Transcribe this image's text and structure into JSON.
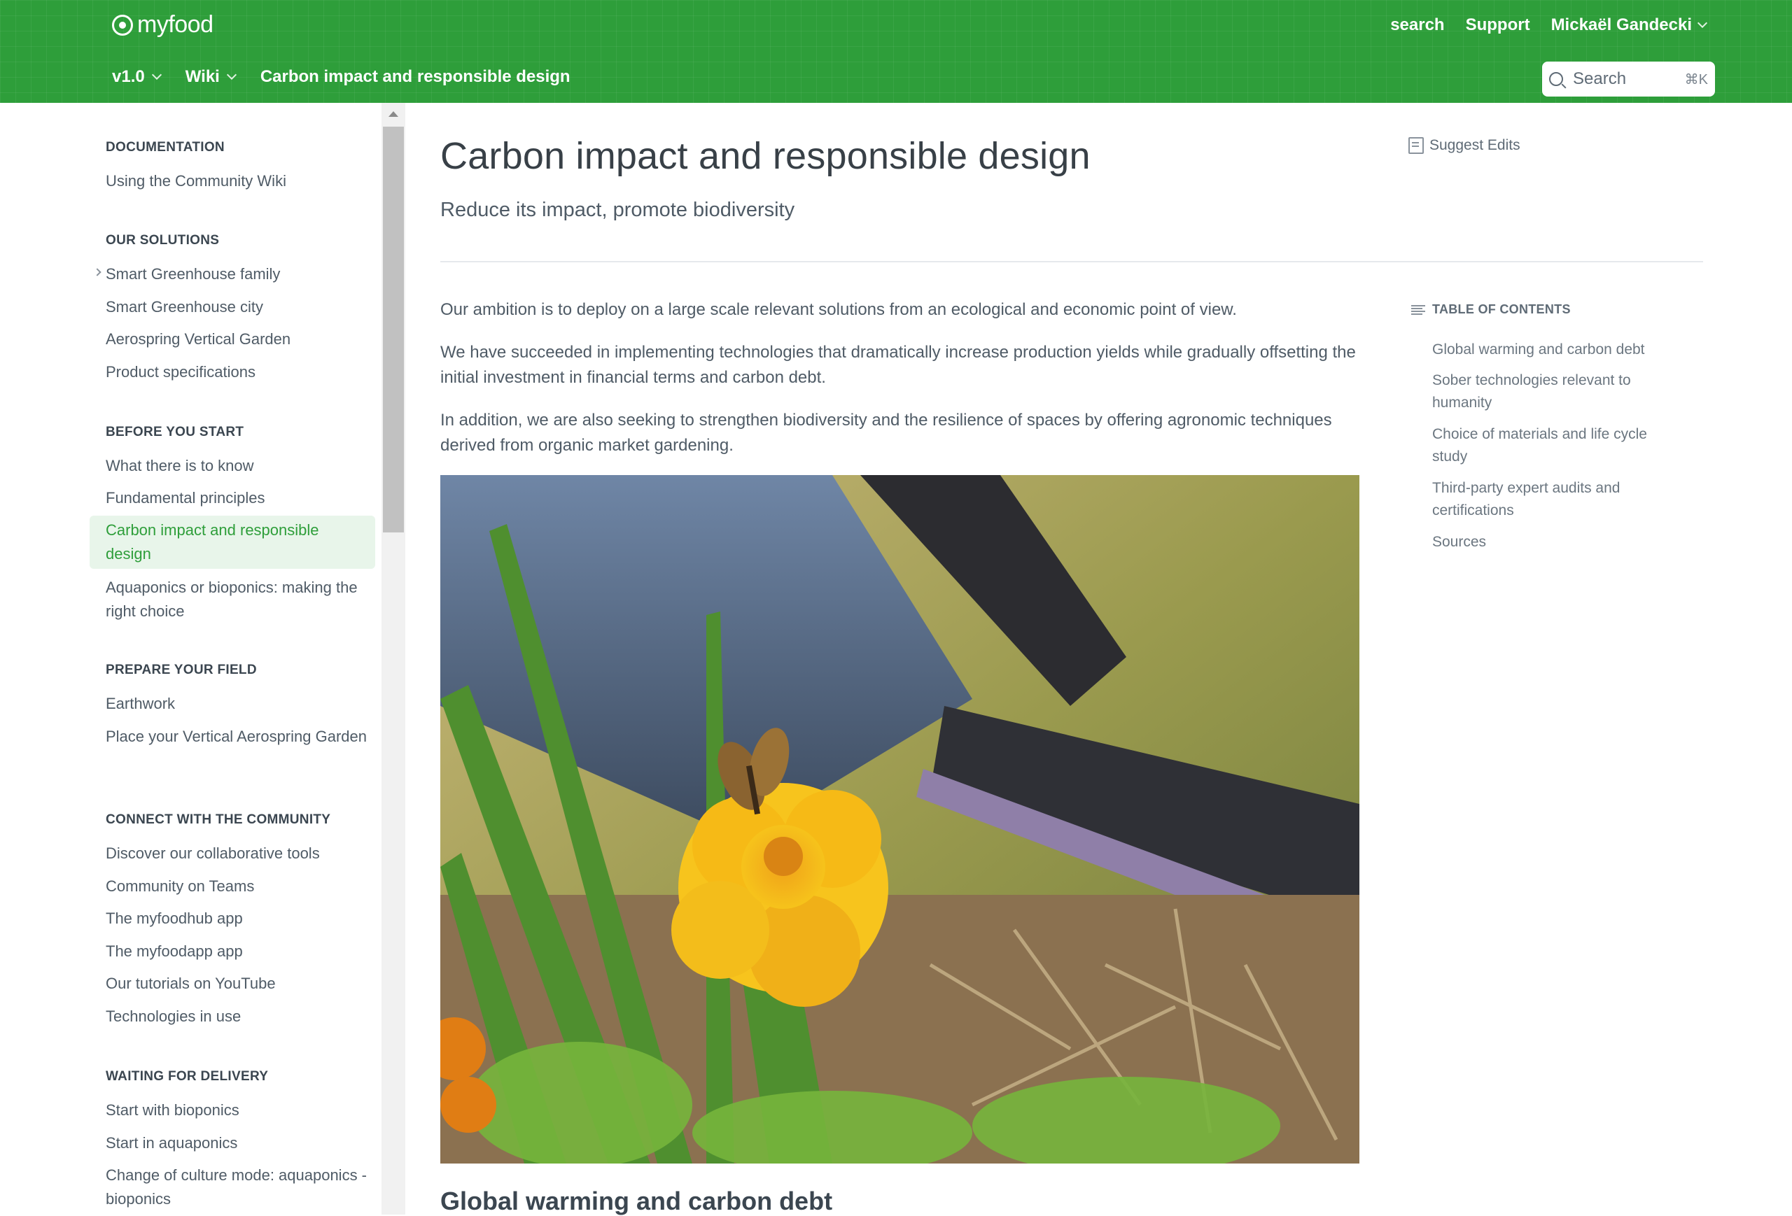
{
  "header": {
    "logo_text": "myfood",
    "top_links": {
      "search": "search",
      "support": "Support",
      "user": "Mickaël Gandecki"
    },
    "subnav": {
      "version": "v1.0",
      "wiki": "Wiki",
      "current": "Carbon impact and responsible design"
    },
    "search": {
      "placeholder": "Search",
      "shortcut": "⌘K"
    },
    "colors": {
      "brand_green": "#2e9e3a"
    }
  },
  "sidebar": {
    "sections": [
      {
        "title": "DOCUMENTATION",
        "items": [
          "Using the Community Wiki"
        ]
      },
      {
        "title": "OUR SOLUTIONS",
        "items": [
          "Smart Greenhouse family",
          "Smart Greenhouse city",
          "Aerospring Vertical Garden",
          "Product specifications"
        ]
      },
      {
        "title": "BEFORE YOU START",
        "items": [
          "What there is to know",
          "Fundamental principles",
          "Carbon impact and responsible design",
          "Aquaponics or bioponics: making the right choice"
        ]
      },
      {
        "title": "PREPARE YOUR FIELD",
        "items": [
          "Earthwork",
          "Place your Vertical Aerospring Garden"
        ]
      },
      {
        "title": "CONNECT WITH THE COMMUNITY",
        "items": [
          "Discover our collaborative tools",
          "Community on Teams",
          "The myfoodhub app",
          "The myfoodapp app",
          "Our tutorials on YouTube",
          "Technologies in use"
        ]
      },
      {
        "title": "WAITING FOR DELIVERY",
        "items": [
          "Start with bioponics",
          "Start in aquaponics",
          "Change of culture mode: aquaponics - bioponics"
        ]
      }
    ]
  },
  "main": {
    "title": "Carbon impact and responsible design",
    "subtitle": "Reduce its impact, promote biodiversity",
    "suggest_edits": "Suggest Edits",
    "paragraphs": [
      "Our ambition is to deploy on a large scale relevant solutions from an ecological and economic point of view.",
      "We have succeeded in implementing technologies that dramatically increase production yields while gradually offsetting the initial investment in financial terms and carbon debt.",
      "In addition, we are also seeking to strengthen biodiversity and the resilience of spaces by offering agronomic techniques derived from organic market gardening."
    ],
    "next_heading": "Global warming and carbon debt"
  },
  "toc": {
    "title": "TABLE OF CONTENTS",
    "items": [
      "Global warming and carbon debt",
      "Sober technologies relevant to humanity",
      "Choice of materials and life cycle study",
      "Third-party expert audits and certifications",
      "Sources"
    ]
  }
}
